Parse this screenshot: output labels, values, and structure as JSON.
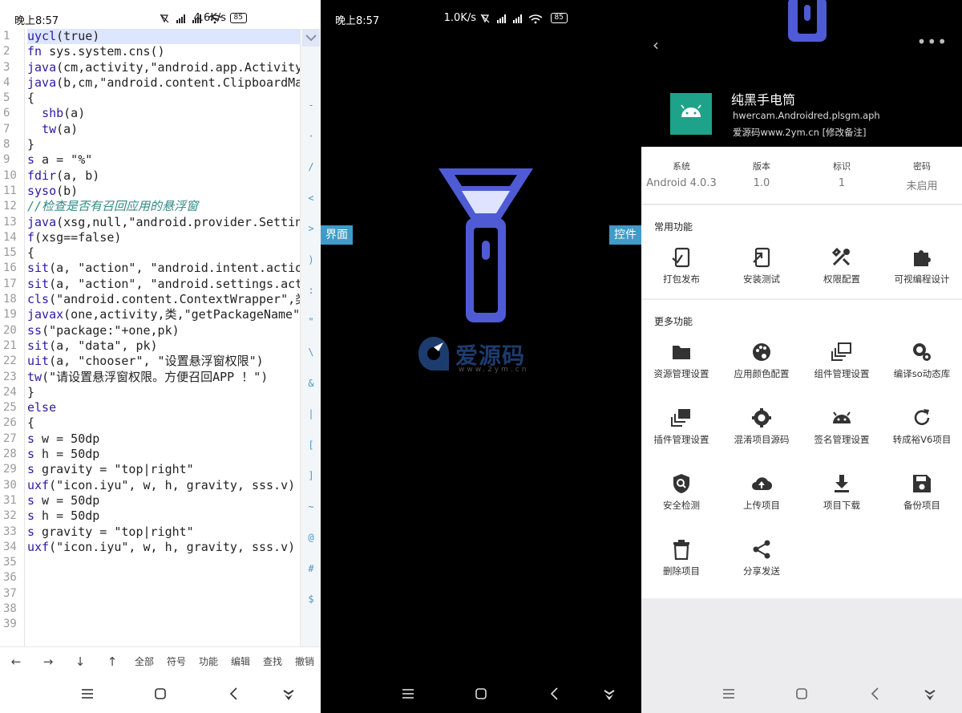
{
  "status_left": {
    "time": "晚上8:57",
    "speed": "4.6K/s",
    "battery": "85"
  },
  "status_mid": {
    "time": "晚上8:57",
    "speed": "1.0K/s",
    "battery": "85"
  },
  "editor": {
    "line_numbers": [
      "1",
      "2",
      "3",
      "4",
      "5",
      "6",
      "7",
      "8",
      "9",
      "10",
      "11",
      "12",
      "13",
      "14",
      "15",
      "16",
      "17",
      "18",
      "19",
      "20",
      "21",
      "22",
      "23",
      "24",
      "25",
      "26",
      "27",
      "28",
      "29",
      "30",
      "31",
      "32",
      "33",
      "34",
      "35",
      "36",
      "37",
      "38",
      "39"
    ],
    "lines": [
      "uycl(true)",
      "fn sys.system.cns()",
      "java(cm,activity,\"android.app.Activity",
      "java(b,cm,\"android.content.ClipboardMa",
      "{",
      "  shb(a)",
      "  tw(a)",
      "}",
      "s a = \"%\"",
      "fdir(a, b)",
      "syso(b)",
      "//检查是否有召回应用的悬浮窗",
      "java(xsg,null,\"android.provider.Settin",
      "f(xsg==false)",
      "{",
      "sit(a, \"action\", \"android.intent.actio",
      "sit(a, \"action\", \"android.settings.act",
      "cls(\"android.content.ContextWrapper\",类",
      "javax(one,activity,类,\"getPackageName\"",
      "ss(\"package:\"+one,pk)",
      "sit(a, \"data\", pk)",
      "uit(a, \"chooser\", \"设置悬浮窗权限\")",
      "tw(\"请设置悬浮窗权限。方便召回APP ！\")",
      "}",
      "else",
      "{",
      "s w = 50dp",
      "s h = 50dp",
      "s gravity = \"top|right\"",
      "uxf(\"icon.iyu\", w, h, gravity, sss.v)",
      "s w = 50dp",
      "s h = 50dp",
      "s gravity = \"top|right\"",
      "uxf(\"icon.iyu\", w, h, gravity, sss.v)",
      "",
      "",
      "",
      "",
      ""
    ],
    "side_symbols": [
      "-",
      "·",
      "/",
      "<",
      ">",
      ")",
      ":",
      "\"",
      "\\",
      "&",
      "|",
      "[",
      "]",
      "~",
      "@",
      "#",
      "$"
    ],
    "toolbar": [
      "←",
      "→",
      "↓",
      "↑",
      "全部",
      "符号",
      "功能",
      "编辑",
      "查找",
      "撤销"
    ]
  },
  "flash": {
    "tag_left": "界面",
    "tag_right": "控件",
    "watermark": "爱源码",
    "watermark_url": "www.2ym.cn"
  },
  "detail": {
    "app_name": "纯黑手电筒",
    "package": "hwercam.Androidred.plsgm.aph",
    "source": "爱源码www.2ym.cn [修改备注]",
    "info": [
      {
        "label": "系统",
        "value": "Android 4.0.3"
      },
      {
        "label": "版本",
        "value": "1.0"
      },
      {
        "label": "标识",
        "value": "1"
      },
      {
        "label": "密码",
        "value": "未启用"
      }
    ],
    "common_title": "常用功能",
    "common": [
      "打包发布",
      "安装测试",
      "权限配置",
      "可视编程设计"
    ],
    "more_title": "更多功能",
    "more": [
      "资源管理设置",
      "应用颜色配置",
      "组件管理设置",
      "编译so动态库",
      "插件管理设置",
      "混淆项目源码",
      "签名管理设置",
      "转成裕V6项目",
      "安全检测",
      "上传项目",
      "项目下载",
      "备份项目",
      "删除项目",
      "分享发送"
    ]
  }
}
